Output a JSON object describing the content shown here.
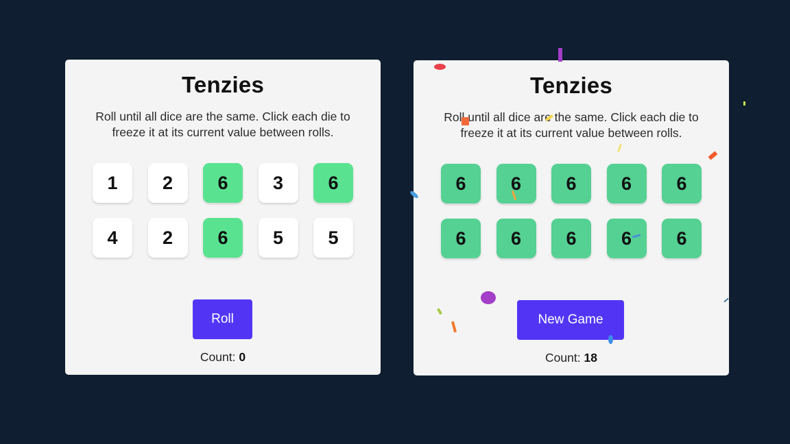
{
  "games": [
    {
      "title": "Tenzies",
      "instructions": "Roll until all dice are the same. Click each die to freeze it at its current value between rolls.",
      "dice": [
        {
          "value": "1",
          "held": false
        },
        {
          "value": "2",
          "held": false
        },
        {
          "value": "6",
          "held": true
        },
        {
          "value": "3",
          "held": false
        },
        {
          "value": "6",
          "held": true
        },
        {
          "value": "4",
          "held": false
        },
        {
          "value": "2",
          "held": false
        },
        {
          "value": "6",
          "held": true
        },
        {
          "value": "5",
          "held": false
        },
        {
          "value": "5",
          "held": false
        }
      ],
      "button_label": "Roll",
      "count_label": "Count:",
      "count_value": "0"
    },
    {
      "title": "Tenzies",
      "instructions": "Roll until all dice are the same. Click each die to freeze it at its current value between rolls.",
      "dice": [
        {
          "value": "6",
          "held": true
        },
        {
          "value": "6",
          "held": true
        },
        {
          "value": "6",
          "held": true
        },
        {
          "value": "6",
          "held": true
        },
        {
          "value": "6",
          "held": true
        },
        {
          "value": "6",
          "held": true
        },
        {
          "value": "6",
          "held": true
        },
        {
          "value": "6",
          "held": true
        },
        {
          "value": "6",
          "held": true
        },
        {
          "value": "6",
          "held": true
        }
      ],
      "button_label": "New Game",
      "count_label": "Count:",
      "count_value": "18"
    }
  ],
  "colors": {
    "background": "#0f1e30",
    "panel": "#f4f4f4",
    "held_die": "#59e391",
    "button": "#5235f4"
  }
}
